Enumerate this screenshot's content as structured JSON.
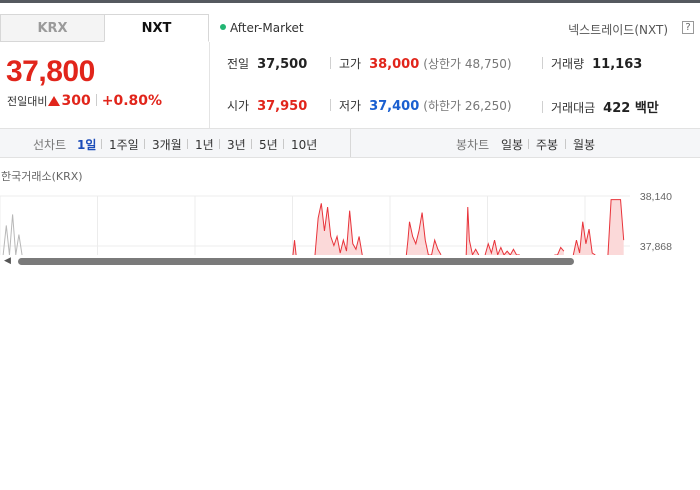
{
  "market_tabs": [
    {
      "label": "KRX",
      "active": false
    },
    {
      "label": "NXT",
      "active": true
    }
  ],
  "session": {
    "label": "After-Market",
    "dot_color": "#22b573"
  },
  "brand": {
    "label": "넥스트레이드(NXT)",
    "help_label": "?"
  },
  "quote": {
    "price": "37,800",
    "change_label": "전일대비",
    "change_value": "300",
    "change_direction": "up",
    "change_percent": "+0.80%"
  },
  "stats": {
    "prev_close": {
      "label": "전일",
      "value": "37,500"
    },
    "high": {
      "label": "고가",
      "value": "38,000",
      "sub": "(상한가 48,750)"
    },
    "volume": {
      "label": "거래량",
      "value": "11,163"
    },
    "open": {
      "label": "시가",
      "value": "37,950"
    },
    "low": {
      "label": "저가",
      "value": "37,400",
      "sub": "(하한가 26,250)"
    },
    "amount": {
      "label": "거래대금",
      "value": "422 백만"
    }
  },
  "toolbar": {
    "line_label": "선차트",
    "line_periods": [
      {
        "label": "1일",
        "active": true
      },
      {
        "label": "1주일",
        "active": false
      },
      {
        "label": "3개월",
        "active": false
      },
      {
        "label": "1년",
        "active": false
      },
      {
        "label": "3년",
        "active": false
      },
      {
        "label": "5년",
        "active": false
      },
      {
        "label": "10년",
        "active": false
      }
    ],
    "candle_label": "봉차트",
    "candle_periods": [
      {
        "label": "일봉",
        "active": false
      },
      {
        "label": "주봉",
        "active": false
      },
      {
        "label": "월봉",
        "active": false
      }
    ]
  },
  "chart_source": "한국거래소(KRX)",
  "colors": {
    "up": "#e1251b",
    "down": "#1a5fd0",
    "line": "#e8333a",
    "fill": "#fbd9d9",
    "grey_line": "#b8b8b8"
  },
  "chart_data": {
    "type": "line",
    "y_ticks": [
      "38,140",
      "37,868"
    ],
    "ylim": [
      37800,
      38140
    ],
    "grid": true,
    "series": [
      {
        "color": "grey",
        "segments": [
          [
            [
              1,
              37600
            ],
            [
              2,
              37980
            ],
            [
              3,
              37600
            ],
            [
              4,
              38040
            ],
            [
              5,
              37600
            ],
            [
              6,
              37930
            ],
            [
              7,
              37600
            ]
          ]
        ]
      },
      {
        "color": "red",
        "segments": [
          [
            [
              93,
              37600
            ],
            [
              93.5,
              37900
            ],
            [
              94,
              37600
            ]
          ],
          [
            [
              100,
              37600
            ],
            [
              101,
              38020
            ],
            [
              102,
              38100
            ],
            [
              103,
              37950
            ],
            [
              104,
              38080
            ],
            [
              105,
              37920
            ],
            [
              106,
              37870
            ],
            [
              107,
              37920
            ],
            [
              108,
              37830
            ],
            [
              109,
              37900
            ],
            [
              110,
              37840
            ],
            [
              111,
              38060
            ],
            [
              112,
              37880
            ],
            [
              113,
              37850
            ],
            [
              114,
              37920
            ],
            [
              115,
              37800
            ]
          ],
          [
            [
              129,
              37600
            ],
            [
              129.5,
              37900
            ],
            [
              130,
              38000
            ],
            [
              131,
              37920
            ],
            [
              132,
              37880
            ],
            [
              133,
              37950
            ],
            [
              134,
              38050
            ],
            [
              135,
              37900
            ],
            [
              136,
              37700
            ],
            [
              137,
              37800
            ],
            [
              138,
              37900
            ],
            [
              139,
              37850
            ],
            [
              140,
              37820
            ]
          ],
          [
            [
              148,
              37600
            ],
            [
              148.5,
              38080
            ],
            [
              149,
              37900
            ],
            [
              150,
              37820
            ],
            [
              151,
              37850
            ],
            [
              152,
              37800
            ]
          ],
          [
            [
              154,
              37600
            ],
            [
              155,
              37880
            ],
            [
              156,
              37830
            ],
            [
              157,
              37900
            ],
            [
              158,
              37820
            ],
            [
              159,
              37860
            ],
            [
              160,
              37800
            ],
            [
              161,
              37840
            ],
            [
              162,
              37800
            ],
            [
              163,
              37850
            ],
            [
              164,
              37800
            ],
            [
              165,
              37820
            ]
          ],
          [
            [
              176,
              37600
            ],
            [
              177,
              37820
            ],
            [
              178,
              37860
            ],
            [
              179,
              37840
            ]
          ],
          [
            [
              182,
              37600
            ],
            [
              183,
              37900
            ],
            [
              184,
              37830
            ],
            [
              185,
              38000
            ],
            [
              186,
              37880
            ],
            [
              187,
              37960
            ],
            [
              188,
              37830
            ],
            [
              189,
              37600
            ]
          ],
          [
            [
              193,
              37600
            ],
            [
              194,
              38120
            ],
            [
              195,
              38120
            ],
            [
              196,
              38120
            ],
            [
              197,
              38120
            ],
            [
              198,
              37900
            ]
          ]
        ]
      }
    ]
  }
}
